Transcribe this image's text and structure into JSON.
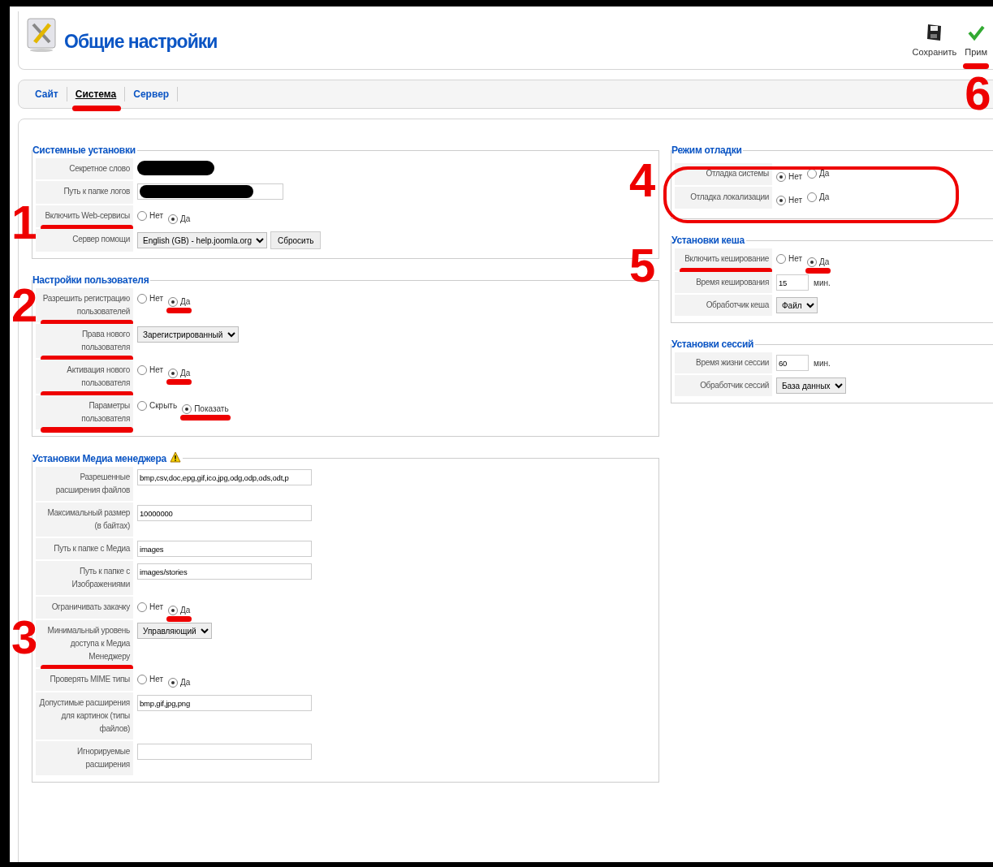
{
  "header": {
    "title": "Общие настройки",
    "toolbar": [
      {
        "label": "Сохранить",
        "kind": "save"
      },
      {
        "label": "Прим",
        "kind": "apply",
        "marked": true,
        "marker": "6"
      }
    ]
  },
  "tabs": [
    {
      "label": "Сайт",
      "selected": false
    },
    {
      "label": "Система",
      "selected": true,
      "marked": true
    },
    {
      "label": "Сервер",
      "selected": false
    }
  ],
  "columns": [
    {
      "fieldsets": [
        {
          "legend": "Системные установки",
          "fields": [
            {
              "label": "Секретное слово",
              "kind": "redacted"
            },
            {
              "label": "Путь к папке логов",
              "kind": "redacted_input"
            },
            {
              "label": "Включить Web-сервисы",
              "kind": "radio",
              "marked": true,
              "marker": "1",
              "options": [
                {
                  "label": "Нет",
                  "selected": false
                },
                {
                  "label": "Да",
                  "selected": true
                }
              ]
            },
            {
              "label": "Сервер помощи",
              "kind": "select",
              "value": "English (GB) - help.joomla.org",
              "button": "Сбросить"
            }
          ]
        },
        {
          "legend": "Настройки пользователя",
          "fields": [
            {
              "label": "Разрешить регистрацию пользователей",
              "kind": "radio",
              "marked": true,
              "marker": "2",
              "options": [
                {
                  "label": "Нет",
                  "selected": false
                },
                {
                  "label": "Да",
                  "selected": true,
                  "marked": true
                }
              ]
            },
            {
              "label": "Права нового пользователя",
              "kind": "select",
              "value": "Зарегистрированный",
              "marked": true
            },
            {
              "label": "Активация нового пользователя",
              "kind": "radio",
              "marked": true,
              "options": [
                {
                  "label": "Нет",
                  "selected": false
                },
                {
                  "label": "Да",
                  "selected": true,
                  "marked": true
                }
              ]
            },
            {
              "label": "Параметры пользователя",
              "kind": "radio",
              "marked": true,
              "options": [
                {
                  "label": "Скрыть",
                  "selected": false
                },
                {
                  "label": "Показать",
                  "selected": true,
                  "marked": true
                }
              ]
            }
          ]
        },
        {
          "legend": "Установки Медиа менеджера",
          "warning": true,
          "fields": [
            {
              "label": "Разрешенные расширения файлов",
              "kind": "text",
              "value": "bmp,csv,doc,epg,gif,ico,jpg,odg,odp,ods,odt,p"
            },
            {
              "label": "Максимальный размер (в байтах)",
              "kind": "text",
              "value": "10000000"
            },
            {
              "label": "Путь к папке с Медиа",
              "kind": "text",
              "value": "images"
            },
            {
              "label": "Путь к папке с Изображениями",
              "kind": "text",
              "value": "images/stories"
            },
            {
              "label": "Ограничивать закачку",
              "kind": "radio",
              "options": [
                {
                  "label": "Нет",
                  "selected": false
                },
                {
                  "label": "Да",
                  "selected": true,
                  "marked": true
                }
              ]
            },
            {
              "label": "Минимальный уровень доступа к Медиа Менеджеру",
              "kind": "select",
              "value": "Управляющий",
              "marked": true,
              "marker": "3"
            },
            {
              "label": "Проверять MIME типы",
              "kind": "radio",
              "options": [
                {
                  "label": "Нет",
                  "selected": false
                },
                {
                  "label": "Да",
                  "selected": true
                }
              ]
            },
            {
              "label": "Допустимые расширения для картинок (типы файлов)",
              "kind": "text",
              "value": "bmp,gif,jpg,png"
            },
            {
              "label": "Игнорируемые расширения",
              "kind": "text"
            }
          ]
        }
      ]
    },
    {
      "fieldsets": [
        {
          "legend": "Режим отладки",
          "circled": true,
          "fields": [
            {
              "label": "Отладка системы",
              "kind": "radio",
              "marker": "4",
              "options": [
                {
                  "label": "Нет",
                  "selected": true
                },
                {
                  "label": "Да",
                  "selected": false
                }
              ]
            },
            {
              "label": "Отладка локализации",
              "kind": "radio",
              "options": [
                {
                  "label": "Нет",
                  "selected": true
                },
                {
                  "label": "Да",
                  "selected": false
                }
              ]
            }
          ]
        },
        {
          "legend": "Установки кеша",
          "fields": [
            {
              "label": "Включить кеширование",
              "kind": "radio",
              "marked": true,
              "marker": "5",
              "options": [
                {
                  "label": "Нет",
                  "selected": false
                },
                {
                  "label": "Да",
                  "selected": true,
                  "marked": true
                }
              ]
            },
            {
              "label": "Время кеширования",
              "kind": "number",
              "value": "15",
              "unit": "мин."
            },
            {
              "label": "Обработчик кеша",
              "kind": "select",
              "value": "Файл"
            }
          ]
        },
        {
          "legend": "Установки сессий",
          "fields": [
            {
              "label": "Время жизни сессии",
              "kind": "number",
              "value": "60",
              "unit": "мин."
            },
            {
              "label": "Обработчик сессий",
              "kind": "select",
              "value": "База данных"
            }
          ]
        }
      ]
    }
  ]
}
